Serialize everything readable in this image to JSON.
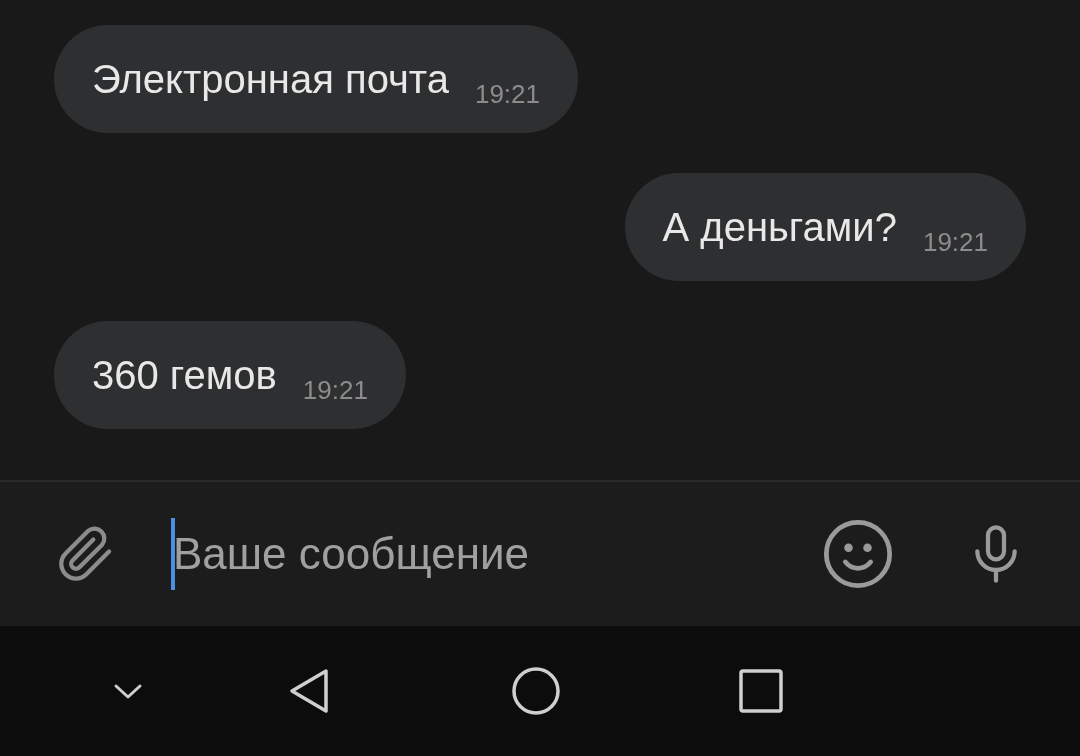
{
  "messages": [
    {
      "kind": "incoming",
      "text": "Электронная почта",
      "time": "19:21"
    },
    {
      "kind": "outgoing",
      "text": "А деньгами?",
      "time": "19:21"
    },
    {
      "kind": "incoming",
      "text": "360 гемов",
      "time": "19:21"
    }
  ],
  "composer": {
    "placeholder": "Ваше сообщение",
    "focused": true
  }
}
